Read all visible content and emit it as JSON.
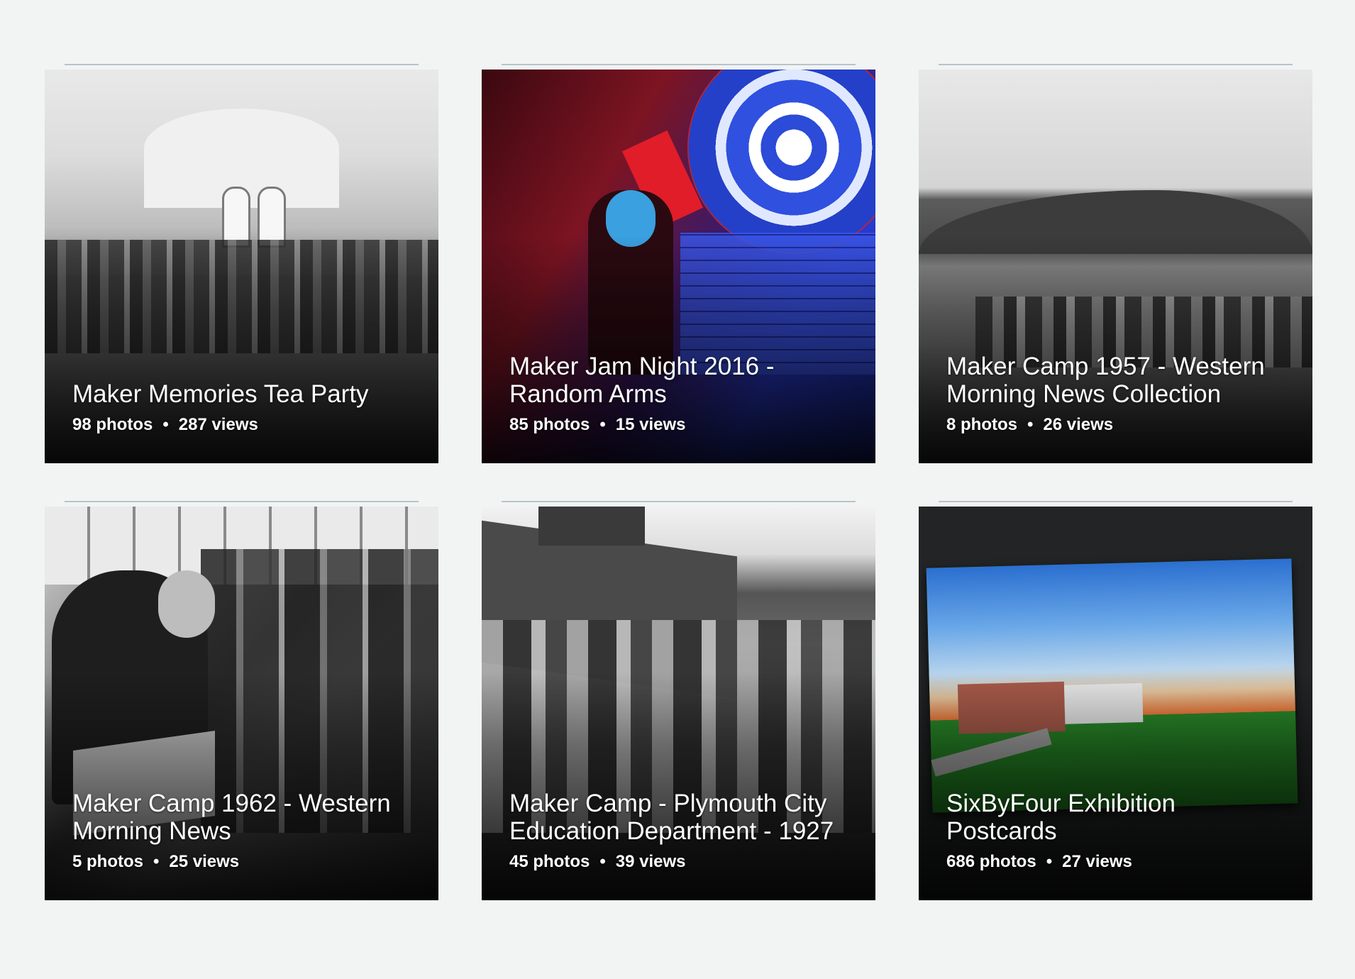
{
  "albums": [
    {
      "title": "Maker Memories Tea Party",
      "photos": "98 photos",
      "views": "287 views"
    },
    {
      "title": "Maker Jam Night 2016 - Random Arms",
      "photos": "85 photos",
      "views": "15 views"
    },
    {
      "title": "Maker Camp 1957 - Western Morning News Collection",
      "photos": "8 photos",
      "views": "26 views"
    },
    {
      "title": "Maker Camp 1962 - Western Morning News",
      "photos": "5 photos",
      "views": "25 views"
    },
    {
      "title": "Maker Camp - Plymouth City Education Department - 1927",
      "photos": "45 photos",
      "views": "39 views"
    },
    {
      "title": "SixByFour Exhibition Postcards",
      "photos": "686 photos",
      "views": "27 views"
    }
  ],
  "separator": "•"
}
